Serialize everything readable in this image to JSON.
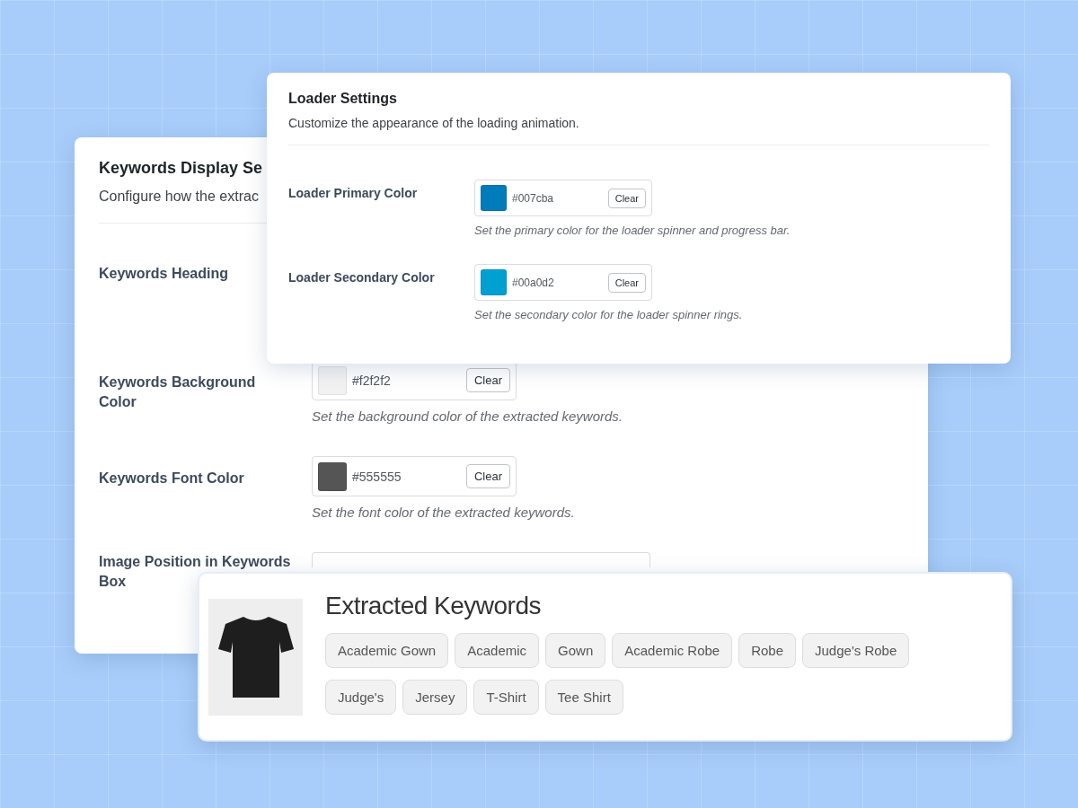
{
  "keywords_settings": {
    "title": "Keywords Display Se",
    "description": "Configure how the extrac",
    "fields": [
      {
        "kind": "plain",
        "label": "Keywords Heading"
      },
      {
        "kind": "color",
        "label": "Keywords Background Color",
        "value": "#f2f2f2",
        "button": "Clear",
        "hint": "Set the background color of the extracted keywords."
      },
      {
        "kind": "color",
        "label": "Keywords Font Color",
        "value": "#555555",
        "button": "Clear",
        "hint": "Set the font color of the extracted keywords."
      },
      {
        "kind": "select",
        "label": "Image Position in Keywords Box"
      }
    ]
  },
  "loader_settings": {
    "title": "Loader Settings",
    "description": "Customize the appearance of the loading animation.",
    "fields": [
      {
        "kind": "color",
        "label": "Loader Primary Color",
        "value": "#007cba",
        "button": "Clear",
        "hint": "Set the primary color for the loader spinner and progress bar."
      },
      {
        "kind": "color",
        "label": "Loader Secondary Color",
        "value": "#00a0d2",
        "button": "Clear",
        "hint": "Set the secondary color for the loader spinner rings."
      }
    ]
  },
  "keywords_preview": {
    "title": "Extracted Keywords",
    "keywords": [
      "Academic Gown",
      "Academic",
      "Gown",
      "Academic Robe",
      "Robe",
      "Judge's Robe",
      "Judge's",
      "Jersey",
      "T-Shirt",
      "Tee Shirt"
    ]
  }
}
